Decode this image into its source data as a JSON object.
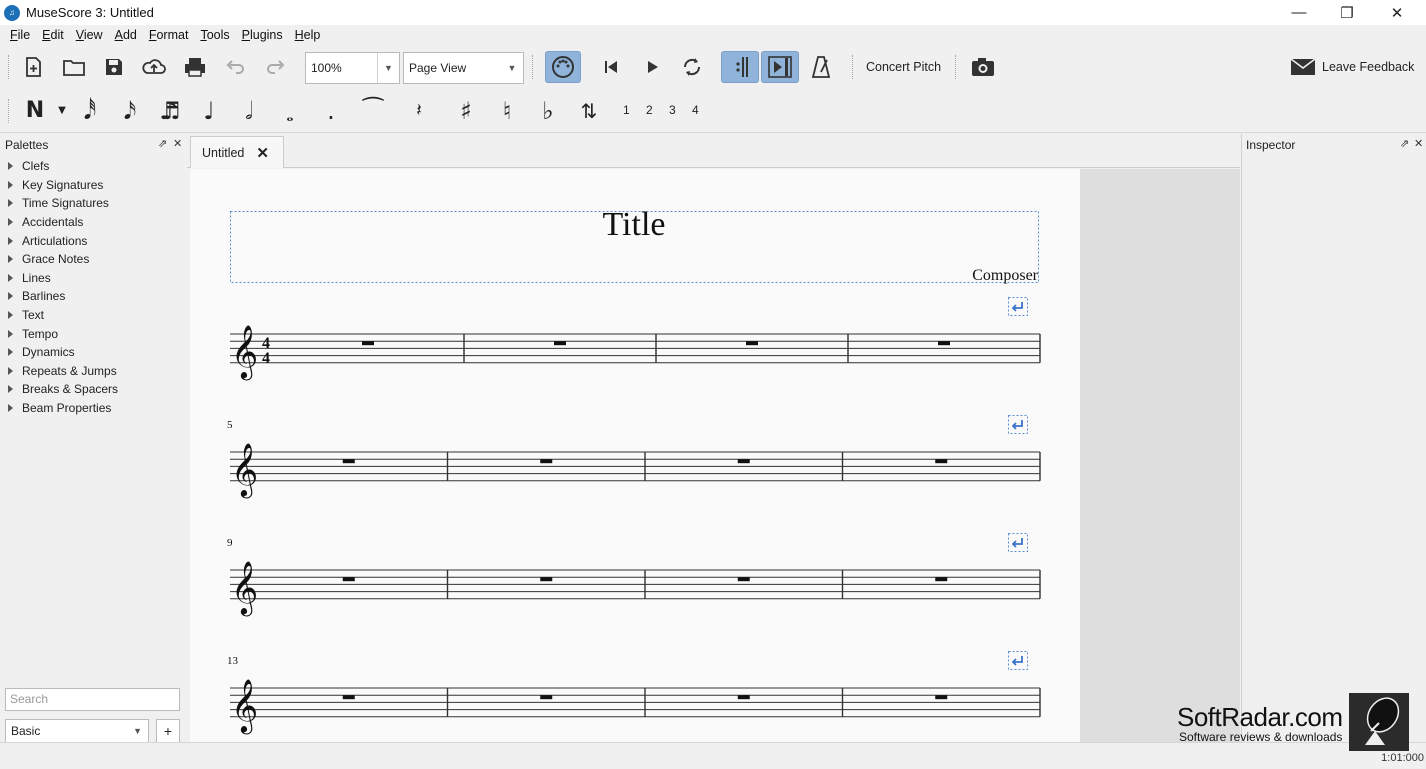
{
  "window": {
    "title": "MuseScore 3: Untitled",
    "app_icon": "musescore-logo"
  },
  "menu": [
    "File",
    "Edit",
    "View",
    "Add",
    "Format",
    "Tools",
    "Plugins",
    "Help"
  ],
  "toolbar": {
    "zoom_value": "100%",
    "view_mode": "Page View",
    "concert_pitch_label": "Concert Pitch",
    "leave_feedback_label": "Leave Feedback"
  },
  "note_input": {
    "voices": [
      "1",
      "2",
      "3",
      "4"
    ]
  },
  "palettes": {
    "title": "Palettes",
    "items": [
      "Clefs",
      "Key Signatures",
      "Time Signatures",
      "Accidentals",
      "Articulations",
      "Grace Notes",
      "Lines",
      "Barlines",
      "Text",
      "Tempo",
      "Dynamics",
      "Repeats & Jumps",
      "Breaks & Spacers",
      "Beam Properties"
    ],
    "search_placeholder": "Search",
    "mode": "Basic",
    "add_label": "+"
  },
  "score": {
    "tab_label": "Untitled",
    "title": "Title",
    "composer": "Composer",
    "time_signature": {
      "numerator": "4",
      "denominator": "4"
    },
    "systems": [
      {
        "start_measure": "",
        "measures": 4
      },
      {
        "start_measure": "5",
        "measures": 4
      },
      {
        "start_measure": "9",
        "measures": 4
      },
      {
        "start_measure": "13",
        "measures": 4
      }
    ]
  },
  "inspector": {
    "title": "Inspector"
  },
  "status": {
    "time": "1:01:000"
  },
  "watermark": {
    "brand": "SoftRadar.com",
    "tagline": "Software reviews & downloads"
  },
  "colors": {
    "accent": "#8fb3d9",
    "frame_dash": "#5b8fd6",
    "brand_blue": "#1d6fb8"
  }
}
